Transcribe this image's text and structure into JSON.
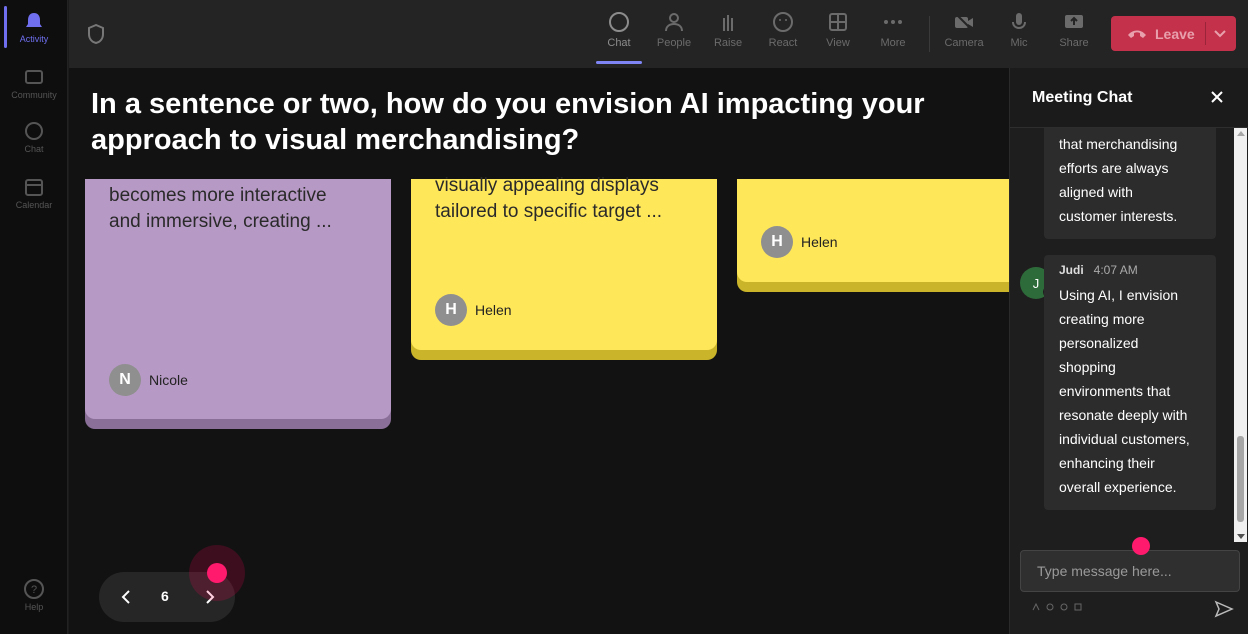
{
  "rail": {
    "items": [
      {
        "label": "Activity",
        "icon": "bell-icon",
        "active": true
      },
      {
        "label": "Community",
        "icon": "community-icon"
      },
      {
        "label": "Chat",
        "icon": "chat-icon"
      },
      {
        "label": "Calendar",
        "icon": "calendar-icon"
      },
      {
        "label": "Help",
        "icon": "help-icon"
      }
    ]
  },
  "toolbar": {
    "buttons": [
      {
        "label": "Chat",
        "icon": "chat-icon",
        "active": true
      },
      {
        "label": "People",
        "icon": "people-icon"
      },
      {
        "label": "Raise",
        "icon": "raise-hand-icon"
      },
      {
        "label": "React",
        "icon": "react-icon"
      },
      {
        "label": "View",
        "icon": "view-grid-icon"
      },
      {
        "label": "More",
        "icon": "more-icon"
      },
      {
        "label": "Camera",
        "icon": "camera-off-icon"
      },
      {
        "label": "Mic",
        "icon": "mic-icon"
      },
      {
        "label": "Share",
        "icon": "share-icon"
      }
    ],
    "leave_label": "Leave"
  },
  "stage": {
    "question": "In a sentence or two, how do you envision AI impacting your approach to visual merchandising?",
    "notes": [
      {
        "lines": [
          "becomes more interactive",
          "and immersive, creating ..."
        ],
        "author": "Nicole",
        "initial": "N",
        "color": "#b799c5",
        "shadow": "#8a6f98"
      },
      {
        "lines": [
          "visually appealing displays",
          "tailored to specific target ..."
        ],
        "author": "Helen",
        "initial": "H",
        "color": "#ffe75a",
        "shadow": "#c9b42a"
      },
      {
        "lines": [],
        "author": "Helen",
        "initial": "H",
        "color": "#ffe75a",
        "shadow": "#c9b42a"
      }
    ],
    "page_number": "6"
  },
  "chat": {
    "title": "Meeting Chat",
    "messages": [
      {
        "lines": [
          "that merchandising",
          "efforts are always",
          "aligned with",
          "customer interests."
        ]
      },
      {
        "author": "Judi",
        "initial": "J",
        "time": "4:07 AM",
        "lines": [
          "Using AI, I envision",
          "creating more",
          "personalized",
          "shopping",
          "environments that",
          "resonate deeply with",
          "individual customers,",
          "enhancing their",
          "overall experience."
        ]
      }
    ],
    "input_placeholder": "Type message here..."
  },
  "colors": {
    "accent": "#7f85f5",
    "leave": "#c4314b",
    "cursor": "#ff1a6e"
  }
}
